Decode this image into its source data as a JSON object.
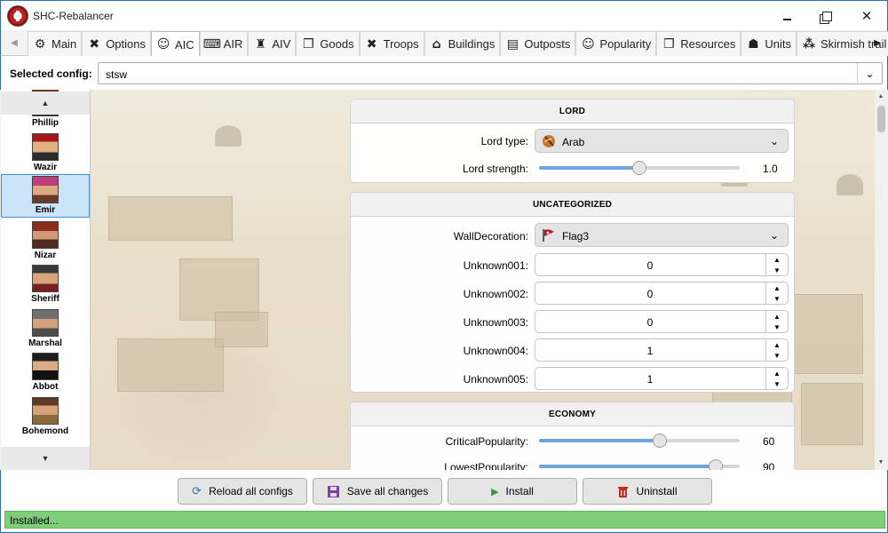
{
  "window": {
    "title": "SHC-Rebalancer"
  },
  "tabs": [
    {
      "label": "Main",
      "icon": "gear-icon",
      "glyph": "⚙"
    },
    {
      "label": "Options",
      "icon": "tools-icon",
      "glyph": "✖"
    },
    {
      "label": "AIC",
      "icon": "robot-icon",
      "glyph": "☺",
      "active": true
    },
    {
      "label": "AIR",
      "icon": "keyboard-icon",
      "glyph": "⌨"
    },
    {
      "label": "AIV",
      "icon": "castle-icon",
      "glyph": "♜"
    },
    {
      "label": "Goods",
      "icon": "box-icon",
      "glyph": "❒"
    },
    {
      "label": "Troops",
      "icon": "swords-icon",
      "glyph": "✖"
    },
    {
      "label": "Buildings",
      "icon": "building-icon",
      "glyph": "⌂"
    },
    {
      "label": "Outposts",
      "icon": "outpost-icon",
      "glyph": "▤"
    },
    {
      "label": "Popularity",
      "icon": "smiley-icon",
      "glyph": "☺"
    },
    {
      "label": "Resources",
      "icon": "cube-icon",
      "glyph": "❒"
    },
    {
      "label": "Units",
      "icon": "users-icon",
      "glyph": "☗"
    },
    {
      "label": "Skirmish trail",
      "icon": "trail-icon",
      "glyph": "⁂"
    }
  ],
  "config": {
    "label": "Selected config:",
    "value": "stsw"
  },
  "lords": [
    {
      "name": "Phillip"
    },
    {
      "name": "Wazir"
    },
    {
      "name": "Emir",
      "selected": true
    },
    {
      "name": "Nizar"
    },
    {
      "name": "Sheriff"
    },
    {
      "name": "Marshal"
    },
    {
      "name": "Abbot"
    },
    {
      "name": "Bohemond"
    }
  ],
  "lord_panel": {
    "header": "LORD",
    "lord_type_label": "Lord type:",
    "lord_type_value": "Arab",
    "lord_strength_label": "Lord strength:",
    "lord_strength_value": "1.0",
    "lord_strength_fraction": 0.5
  },
  "uncat_panel": {
    "header": "UNCATEGORIZED",
    "wall_label": "WallDecoration:",
    "wall_value": "Flag3",
    "fields": [
      {
        "label": "Unknown001:",
        "value": "0"
      },
      {
        "label": "Unknown002:",
        "value": "0"
      },
      {
        "label": "Unknown003:",
        "value": "0"
      },
      {
        "label": "Unknown004:",
        "value": "1"
      },
      {
        "label": "Unknown005:",
        "value": "1"
      }
    ]
  },
  "economy_panel": {
    "header": "ECONOMY",
    "sliders": [
      {
        "label": "CriticalPopularity:",
        "value": "60",
        "fraction": 0.6
      },
      {
        "label": "LowestPopularity:",
        "value": "90",
        "fraction": 0.88
      }
    ]
  },
  "buttons": {
    "reload": "Reload all configs",
    "save": "Save all changes",
    "install": "Install",
    "uninstall": "Uninstall"
  },
  "status": {
    "text": "Installed...",
    "color": "#7fcf7a"
  },
  "colors": {
    "accent": "#2c6fb5",
    "slider_fill": "#6fa6dc",
    "selected_bg": "#cce4f7"
  }
}
